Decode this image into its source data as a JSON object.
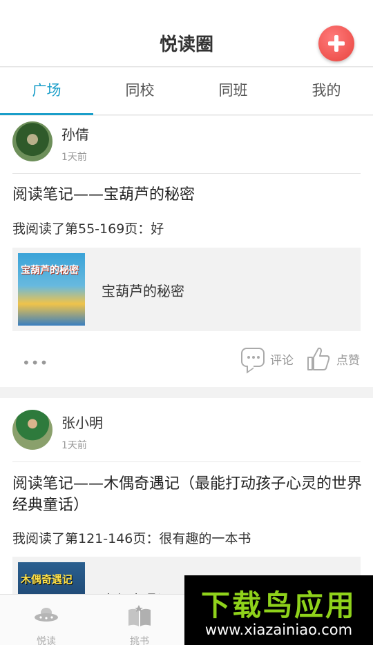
{
  "header": {
    "title": "悦读圈"
  },
  "tabs": [
    {
      "label": "广场",
      "active": true
    },
    {
      "label": "同校",
      "active": false
    },
    {
      "label": "同班",
      "active": false
    },
    {
      "label": "我的",
      "active": false
    }
  ],
  "posts": [
    {
      "user": "孙倩",
      "time": "1天前",
      "title": "阅读笔记——宝葫芦的秘密",
      "content": "我阅读了第55-169页：好",
      "book": {
        "name": "宝葫芦的秘密",
        "cover_text": "宝葫芦的秘密"
      },
      "actions": {
        "more": "•••",
        "comment": "评论",
        "like": "点赞"
      }
    },
    {
      "user": "张小明",
      "time": "1天前",
      "title": "阅读笔记——木偶奇遇记（最能打动孩子心灵的世界经典童话）",
      "content": "我阅读了第121-146页：很有趣的一本书",
      "book": {
        "name": "木偶奇遇记",
        "cover_text": "木偶奇遇记"
      }
    }
  ],
  "bottom_nav": [
    {
      "label": "悦读",
      "icon": "ufo-icon"
    },
    {
      "label": "挑书",
      "icon": "book-icon"
    }
  ],
  "watermark": {
    "title": "下载鸟应用",
    "url": "www.xiazainiao.com"
  },
  "colors": {
    "accent": "#1a9ec9",
    "add_button": "#e8443e",
    "watermark_green": "#8fd21b"
  }
}
